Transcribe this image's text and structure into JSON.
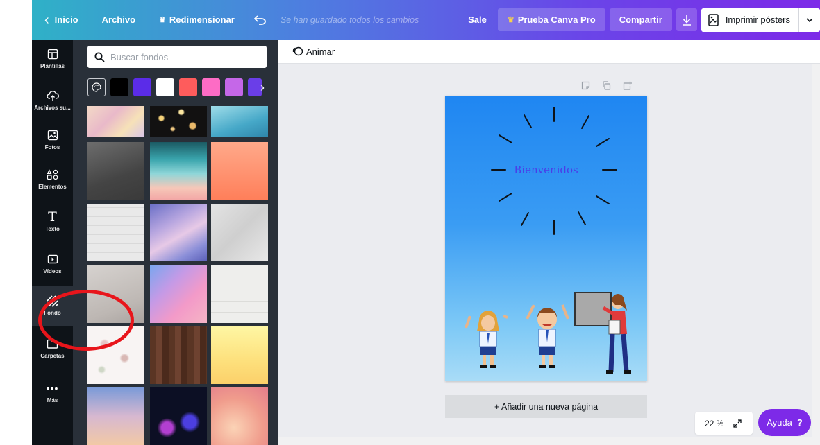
{
  "topbar": {
    "home_label": "Inicio",
    "file_label": "Archivo",
    "resize_label": "Redimensionar",
    "saved_status": "Se han guardado todos los cambios",
    "sale_label": "Sale",
    "pro_label": "Prueba Canva Pro",
    "share_label": "Compartir",
    "print_label": "Imprimir pósters"
  },
  "sidebar": {
    "items": [
      {
        "label": "Plantillas",
        "icon": "layout-icon"
      },
      {
        "label": "Archivos su...",
        "icon": "cloud-upload-icon"
      },
      {
        "label": "Fotos",
        "icon": "image-icon"
      },
      {
        "label": "Elementos",
        "icon": "shapes-icon"
      },
      {
        "label": "Texto",
        "icon": "text-icon"
      },
      {
        "label": "Vídeos",
        "icon": "video-icon"
      },
      {
        "label": "Fondo",
        "icon": "background-icon"
      },
      {
        "label": "Carpetas",
        "icon": "folder-icon"
      },
      {
        "label": "Más",
        "icon": "more-icon"
      }
    ]
  },
  "panel": {
    "search_placeholder": "Buscar fondos",
    "swatch_colors": [
      "#000000",
      "#5b2ce8",
      "#ffffff",
      "#fe5c5c",
      "#fd6cc5",
      "#c567e8",
      "#6a3ee8"
    ]
  },
  "editor": {
    "animate_label": "Animar",
    "canvas_text": "Bienvenidos",
    "add_page_label": "+ Añadir una nueva página",
    "zoom_label": "22 %",
    "help_label": "Ayuda",
    "help_mark": "?"
  },
  "colors": {
    "accent": "#7d2ae8",
    "sidebar_bg": "#0e1318",
    "panel_bg": "#293039",
    "annotation": "#e8151b"
  }
}
